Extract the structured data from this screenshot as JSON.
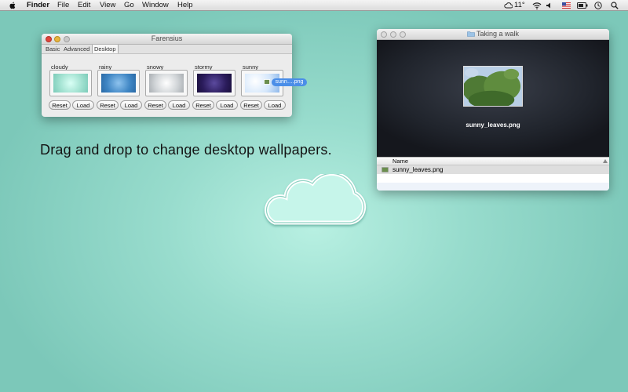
{
  "menubar": {
    "app_name": "Finder",
    "items": [
      "File",
      "Edit",
      "View",
      "Go",
      "Window",
      "Help"
    ],
    "weather": "11°"
  },
  "prefs_window": {
    "title": "Farensius",
    "tabs": [
      "Basic",
      "Advanced",
      "Desktop"
    ],
    "selected_tab": "Desktop",
    "slots": [
      {
        "label": "cloudy",
        "color": "#9fe0cf"
      },
      {
        "label": "rainy",
        "color": "#3f86c4"
      },
      {
        "label": "snowy",
        "color": "#cfd3d6"
      },
      {
        "label": "stormy",
        "color": "#2b1c5c"
      },
      {
        "label": "sunny",
        "color": "#d5e7fb"
      }
    ],
    "reset_label": "Reset",
    "load_label": "Load",
    "drag_file": "sunn….png"
  },
  "finder_window": {
    "title": "Taking a walk",
    "preview_name": "sunny_leaves.png",
    "column_header": "Name",
    "files": [
      "sunny_leaves.png"
    ]
  },
  "headline": "Drag and drop to change desktop wallpapers.",
  "colors": {
    "desktop": "#98dccd",
    "selection": "#4b8ee8"
  }
}
